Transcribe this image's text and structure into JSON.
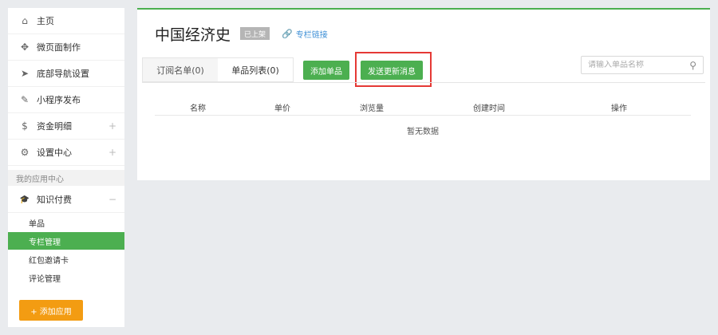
{
  "sidebar": {
    "items": [
      {
        "label": "主页",
        "icon": "home-icon",
        "glyph": "⌂"
      },
      {
        "label": "微页面制作",
        "icon": "move-icon",
        "glyph": "✥"
      },
      {
        "label": "底部导航设置",
        "icon": "navigation-arrow-icon",
        "glyph": "➤"
      },
      {
        "label": "小程序发布",
        "icon": "edit-icon",
        "glyph": "✎"
      },
      {
        "label": "资金明细",
        "icon": "money-bag-icon",
        "glyph": "$",
        "expand": "+"
      },
      {
        "label": "设置中心",
        "icon": "gear-icon",
        "glyph": "⚙",
        "expand": "+"
      }
    ],
    "section_label": "我的应用中心",
    "app_group": {
      "label": "知识付费",
      "icon": "graduation-cap-icon",
      "glyph": "🎓",
      "collapse": "−"
    },
    "sub_items": [
      {
        "label": "单品",
        "active": false
      },
      {
        "label": "专栏管理",
        "active": true
      },
      {
        "label": "红包邀请卡",
        "active": false
      },
      {
        "label": "评论管理",
        "active": false
      }
    ],
    "add_app_label": "+ 添加应用"
  },
  "header": {
    "title": "中国经济史",
    "tag": "已上架",
    "link_label": "专栏链接",
    "link_icon": "link-icon"
  },
  "tabs": [
    {
      "label": "订阅名单(0)",
      "active": false
    },
    {
      "label": "单品列表(0)",
      "active": true
    }
  ],
  "buttons": {
    "add_item": "添加单品",
    "send_update": "发送更新消息"
  },
  "search": {
    "placeholder": "请输入单品名称",
    "icon": "search-icon"
  },
  "table": {
    "columns": [
      "名称",
      "单价",
      "浏览量",
      "创建时间",
      "操作"
    ],
    "empty_text": "暂无数据"
  },
  "colors": {
    "accent": "#4caf50",
    "highlight": "#e53935",
    "add_button": "#f39c12",
    "link": "#3d8fd6"
  }
}
